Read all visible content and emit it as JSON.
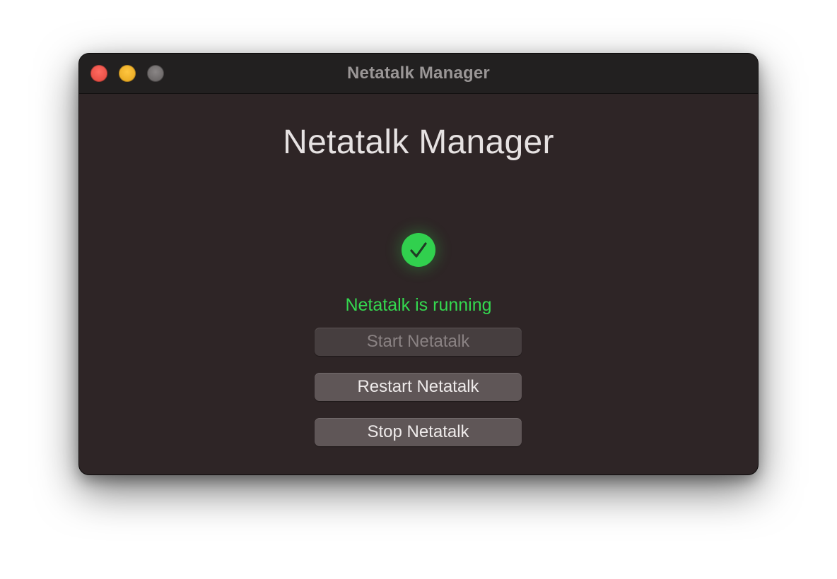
{
  "window": {
    "title": "Netatalk Manager"
  },
  "main": {
    "heading": "Netatalk Manager",
    "status": {
      "icon": "checkmark-circle-icon",
      "text": "Netatalk is running",
      "color": "#34d84f"
    },
    "buttons": {
      "start": {
        "label": "Start Netatalk",
        "enabled": false
      },
      "restart": {
        "label": "Restart Netatalk",
        "enabled": true
      },
      "stop": {
        "label": "Stop Netatalk",
        "enabled": true
      }
    }
  },
  "colors": {
    "window_bg": "#2e2526",
    "titlebar_bg": "#222020",
    "close": "#e0443b",
    "minimize": "#e3a21a",
    "zoom": "#6f6b6b",
    "status_green": "#31d04e"
  }
}
